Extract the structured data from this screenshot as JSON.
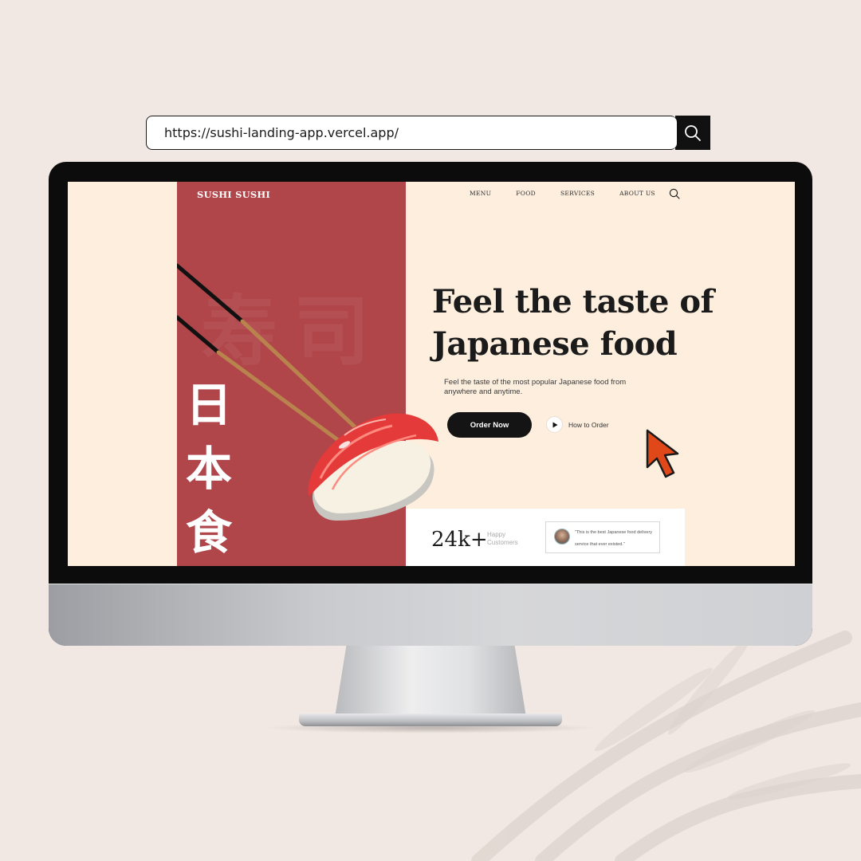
{
  "browser": {
    "url": "https://sushi-landing-app.vercel.app/",
    "search_icon": "search-icon"
  },
  "site": {
    "brand": "SUSHI SUSHI",
    "nav": [
      "MENU",
      "FOOD",
      "SERVICES",
      "ABOUT US"
    ],
    "nav_search_icon": "search-icon",
    "side_kanji": [
      "日",
      "本",
      "食"
    ],
    "bg_kanji": "寿司",
    "headline": [
      "Feel the taste of",
      "Japanese food"
    ],
    "subtext": "Feel the taste of the most popular Japanese food from anywhere and anytime.",
    "order_button": "Order Now",
    "how_to_order": "How to Order",
    "stats": {
      "number": "24k+",
      "label": "Happy Customers"
    },
    "review": {
      "quote": "\"This is the best Japanese food delivery service that ever existed.\""
    }
  },
  "colors": {
    "background": "#f1e8e3",
    "screen_bg": "#fdeede",
    "accent_red": "#b0454a",
    "cursor": "#e0481a"
  }
}
